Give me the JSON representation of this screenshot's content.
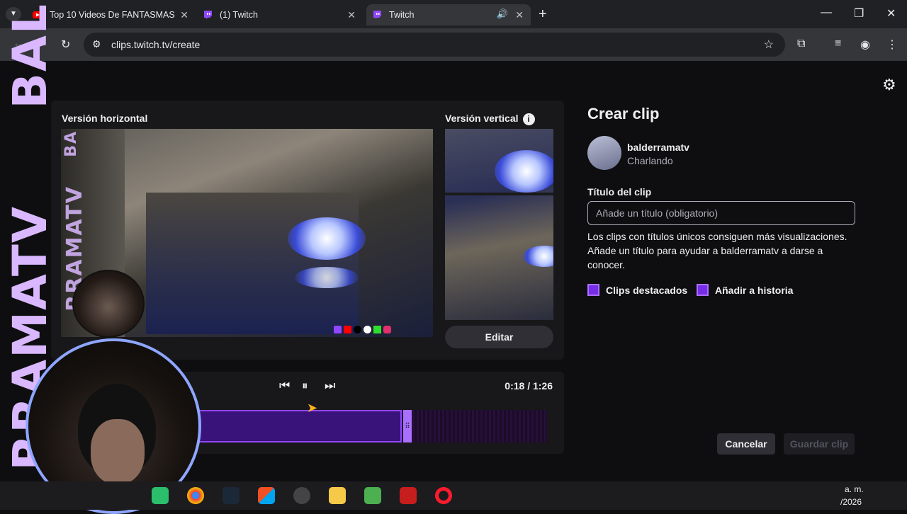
{
  "browser": {
    "tabs": [
      {
        "title": "Top 10 Videos De FANTASMAS",
        "active": false
      },
      {
        "title": "(1) Twitch",
        "active": false
      },
      {
        "title": "Twitch",
        "active": true
      }
    ],
    "url": "clips.twitch.tv/create"
  },
  "clip_editor": {
    "horizontal_label": "Versión horizontal",
    "vertical_label": "Versión vertical",
    "info_glyph": "i",
    "edit_button": "Editar",
    "timecode": "0:18 / 1:26",
    "selection_fraction": 0.61
  },
  "create_panel": {
    "heading": "Crear clip",
    "channel_name": "balderramatv",
    "category": "Charlando",
    "title_label": "Título del clip",
    "title_placeholder": "Añade un título (obligatorio)",
    "help_text": "Los clips con títulos únicos consiguen más visualizaciones. Añade un título para ayudar a balderramatv a darse a conocer.",
    "checkbox_featured": "Clips destacados",
    "checkbox_story": "Añadir a historia",
    "cancel_button": "Cancelar",
    "save_button": "Guardar clip"
  },
  "overlay": {
    "brand_left": "RRAMATV",
    "brand_left_top": "BAL",
    "brand_video": "RRAMATV",
    "brand_video_top": "BA",
    "taskbar_time_top": "a. m.",
    "taskbar_date": "/2026"
  },
  "colors": {
    "accent": "#9147ff",
    "background": "#0e0e10",
    "card": "#18181b"
  }
}
